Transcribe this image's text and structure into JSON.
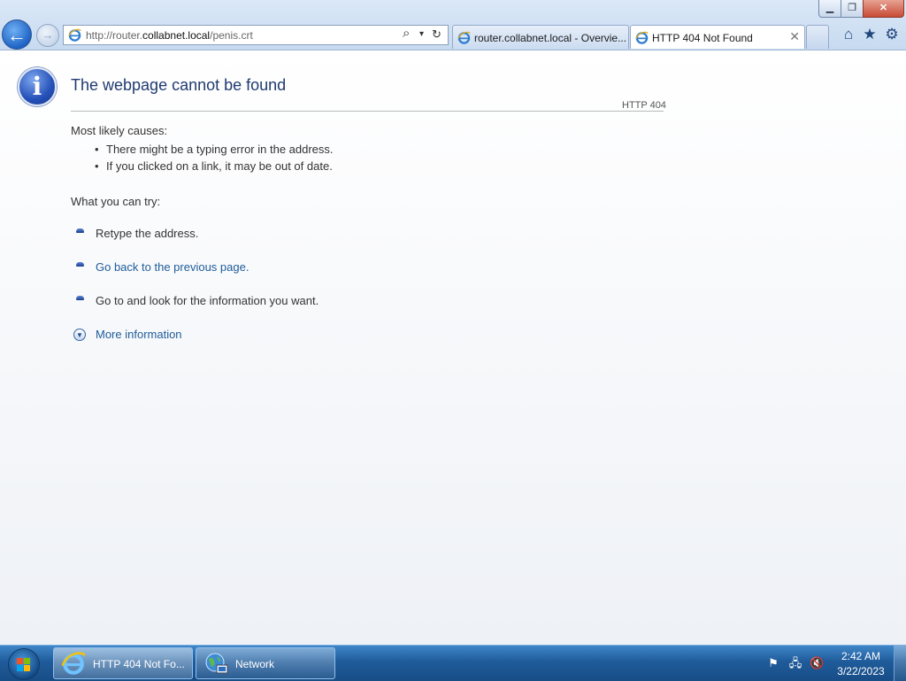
{
  "window": {
    "minimize_icon": "minimize-icon",
    "restore_icon": "restore-icon",
    "close_icon": "close-icon",
    "minimize_glyph": "▁",
    "restore_glyph": "❐",
    "close_glyph": "✕"
  },
  "nav": {
    "back_glyph": "←",
    "forward_glyph": "→"
  },
  "address": {
    "prefix": "http://router.",
    "domain": "collabnet.local",
    "path": "/penis.crt",
    "search_glyph": "⌕",
    "dropdown_glyph": "▾",
    "refresh_glyph": "↻"
  },
  "tabs": [
    {
      "label": "router.collabnet.local - Overvie...",
      "active": false
    },
    {
      "label": "HTTP 404 Not Found",
      "active": true,
      "close_glyph": "✕"
    }
  ],
  "commands": {
    "home_glyph": "⌂",
    "favorites_glyph": "★",
    "tools_glyph": "⚙"
  },
  "page": {
    "title": "The webpage cannot be found",
    "http_code": "HTTP 404",
    "causes_heading": "Most likely causes:",
    "causes": [
      "There might be a typing error in the address.",
      "If you clicked on a link, it may be out of date."
    ],
    "bullet": "•",
    "try_heading": "What you can try:",
    "try": [
      "Retype the address.",
      "Go back to the previous page.",
      "Go to  and look for the information you want."
    ],
    "more_info": "More information",
    "info_glyph": "i",
    "more_glyph": "▼"
  },
  "taskbar": {
    "items": [
      {
        "label": "HTTP 404 Not Fo...",
        "icon": "ie-icon"
      },
      {
        "label": "Network",
        "icon": "network-icon"
      }
    ],
    "tray": {
      "flag_glyph": "⚑",
      "network_glyph": "🖧",
      "volume_glyph": "🔇"
    },
    "clock": {
      "time": "2:42 AM",
      "date": "3/22/2023"
    }
  },
  "colors": {
    "link": "#1f5c9a",
    "title": "#1f3a70",
    "taskbar": "#1f5b9a",
    "chrome": "#c7daf0"
  }
}
